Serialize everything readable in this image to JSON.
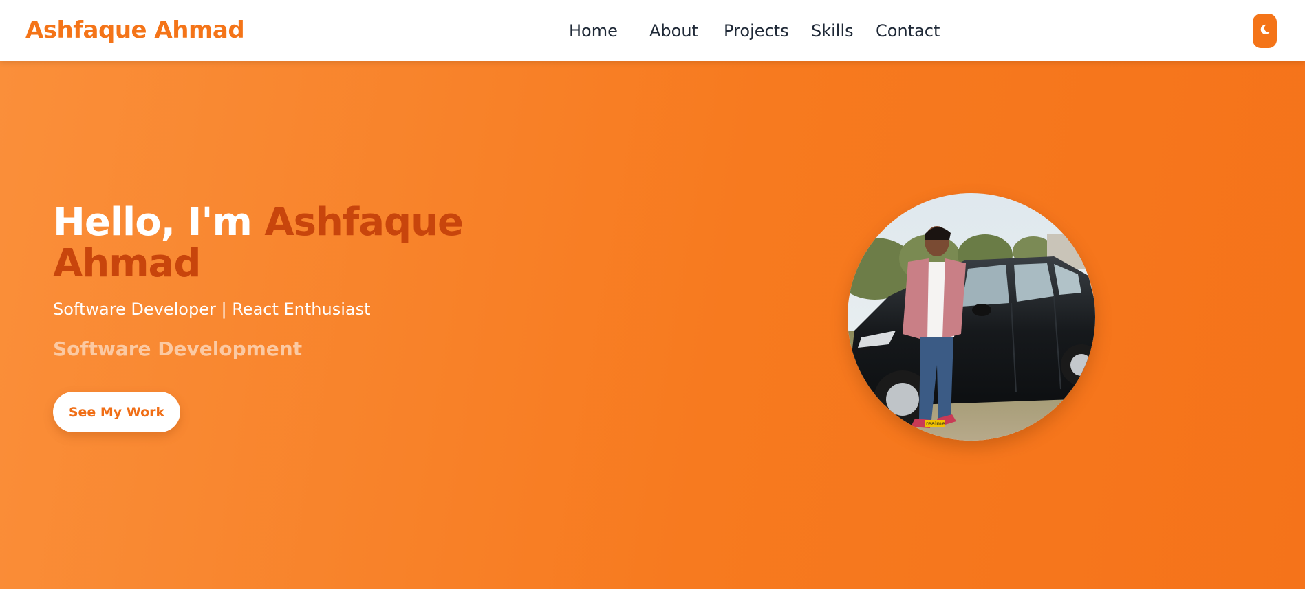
{
  "header": {
    "brand": "Ashfaque Ahmad",
    "nav": [
      {
        "label": "Home"
      },
      {
        "label": "About"
      },
      {
        "label": "Projects"
      },
      {
        "label": "Skills"
      },
      {
        "label": "Contact"
      }
    ],
    "theme_toggle_icon": "moon-icon"
  },
  "hero": {
    "greeting": "Hello, I'm ",
    "name": "Ashfaque Ahmad",
    "subtitle": "Software Developer | React Enthusiast",
    "role": "Software Development",
    "cta_label": "See My Work",
    "photo_watermark": "realme"
  },
  "colors": {
    "accent": "#f47418",
    "name_highlight": "#c8450c",
    "hero_gradient_start": "#fa8f3a",
    "hero_gradient_end": "#f5731a",
    "role_text": "#fbc9a2"
  }
}
